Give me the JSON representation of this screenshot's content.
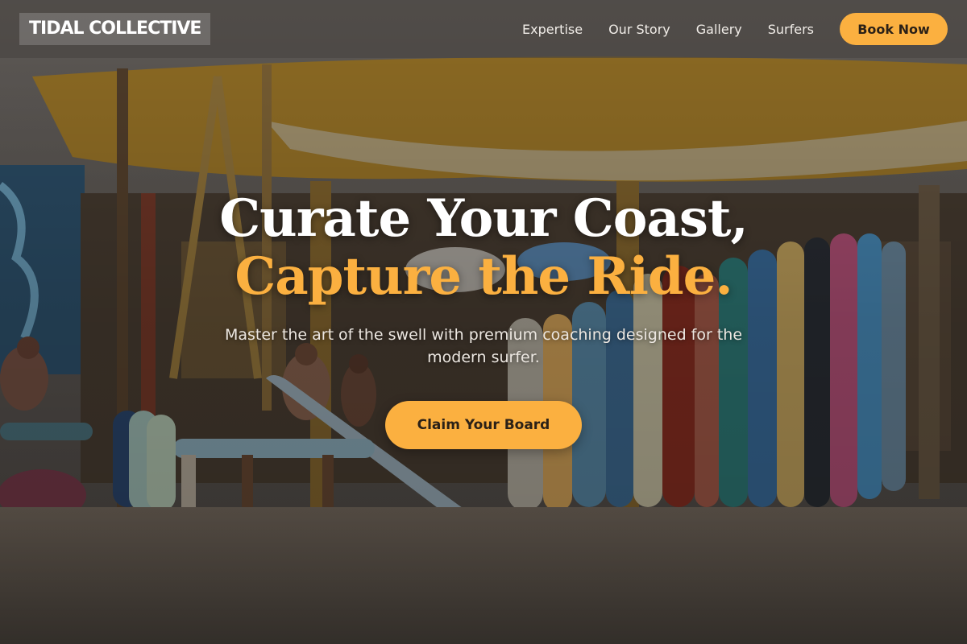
{
  "brand": {
    "logo_text": "TIDAL COLLECTIVE"
  },
  "nav": {
    "links": [
      {
        "label": "Expertise"
      },
      {
        "label": "Our Story"
      },
      {
        "label": "Gallery"
      },
      {
        "label": "Surfers"
      }
    ],
    "cta_label": "Book Now"
  },
  "hero": {
    "headline_line1": "Curate Your Coast,",
    "headline_line2": "Capture the Ride.",
    "subheadline": "Master the art of the swell with premium coaching designed for the modern surfer.",
    "cta_label": "Claim Your Board",
    "background_image": "beach-surf-shop-photo"
  },
  "colors": {
    "accent": "#fbb040",
    "cta_text": "#2b2117",
    "headline_text": "#ffffff",
    "nav_background": "#46423e"
  }
}
